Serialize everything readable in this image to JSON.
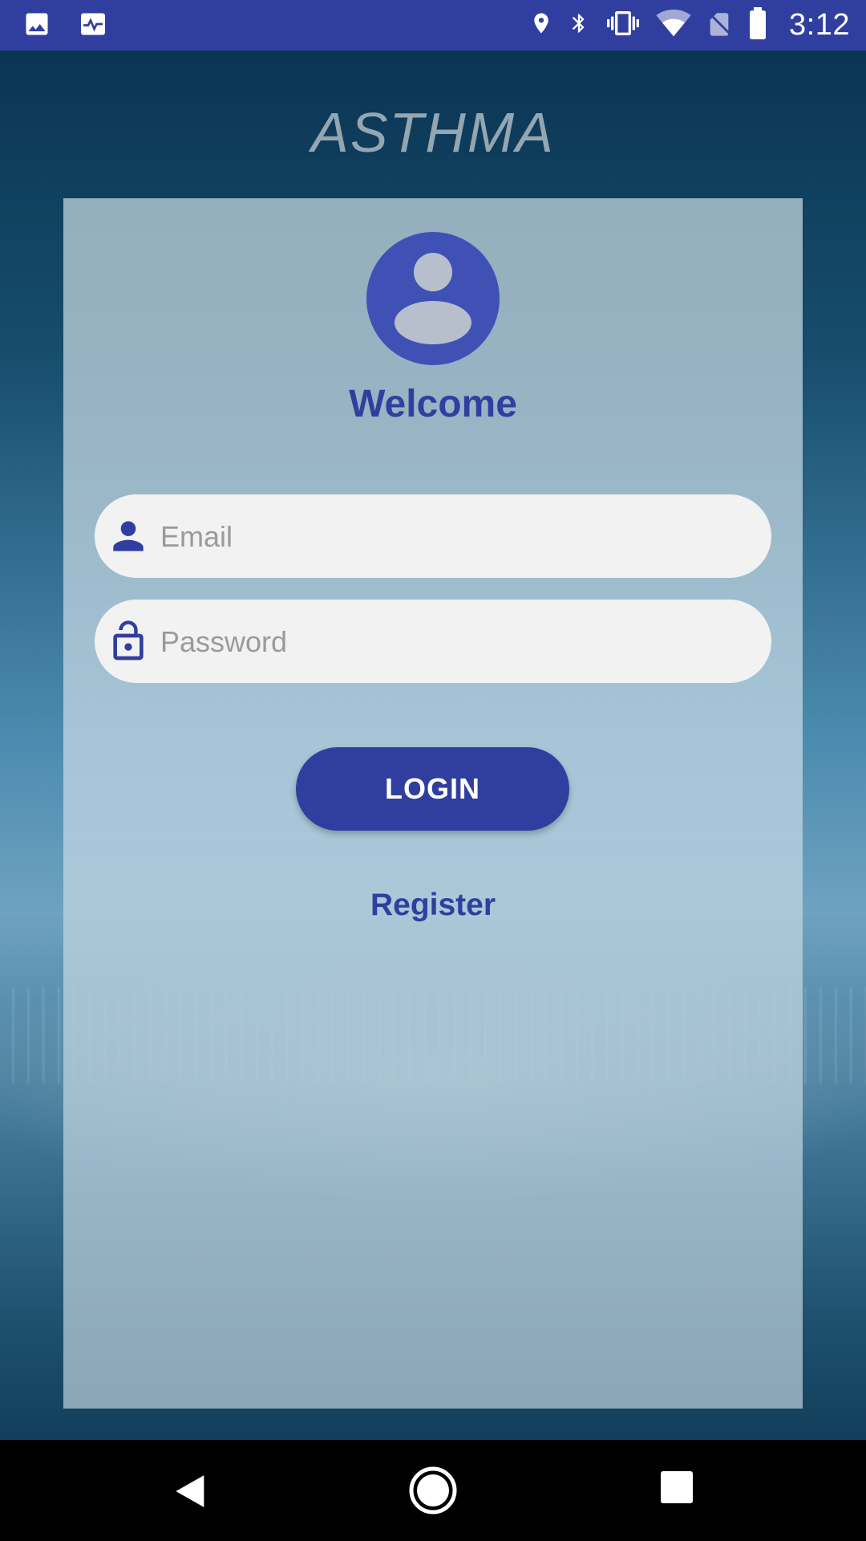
{
  "status_bar": {
    "time": "3:12",
    "left_icons": [
      "image-icon",
      "activity-icon"
    ],
    "right_icons": [
      "location-icon",
      "bluetooth-icon",
      "vibrate-icon",
      "wifi-icon",
      "no-sim-icon",
      "battery-icon"
    ]
  },
  "app": {
    "title": "ASTHMA"
  },
  "login_card": {
    "avatar_icon": "account-circle-icon",
    "welcome_text": "Welcome",
    "email_field": {
      "placeholder": "Email",
      "value": "",
      "icon": "person-icon"
    },
    "password_field": {
      "placeholder": "Password",
      "value": "",
      "icon": "lock-open-icon"
    },
    "login_button_label": "LOGIN",
    "register_link_label": "Register"
  },
  "nav_bar": {
    "buttons": [
      "back-icon",
      "home-icon",
      "recents-icon"
    ]
  },
  "colors": {
    "primary": "#303f9f",
    "avatar": "#3f51b5",
    "field_background": "#f2f2f2",
    "title": "#93a6b2"
  }
}
